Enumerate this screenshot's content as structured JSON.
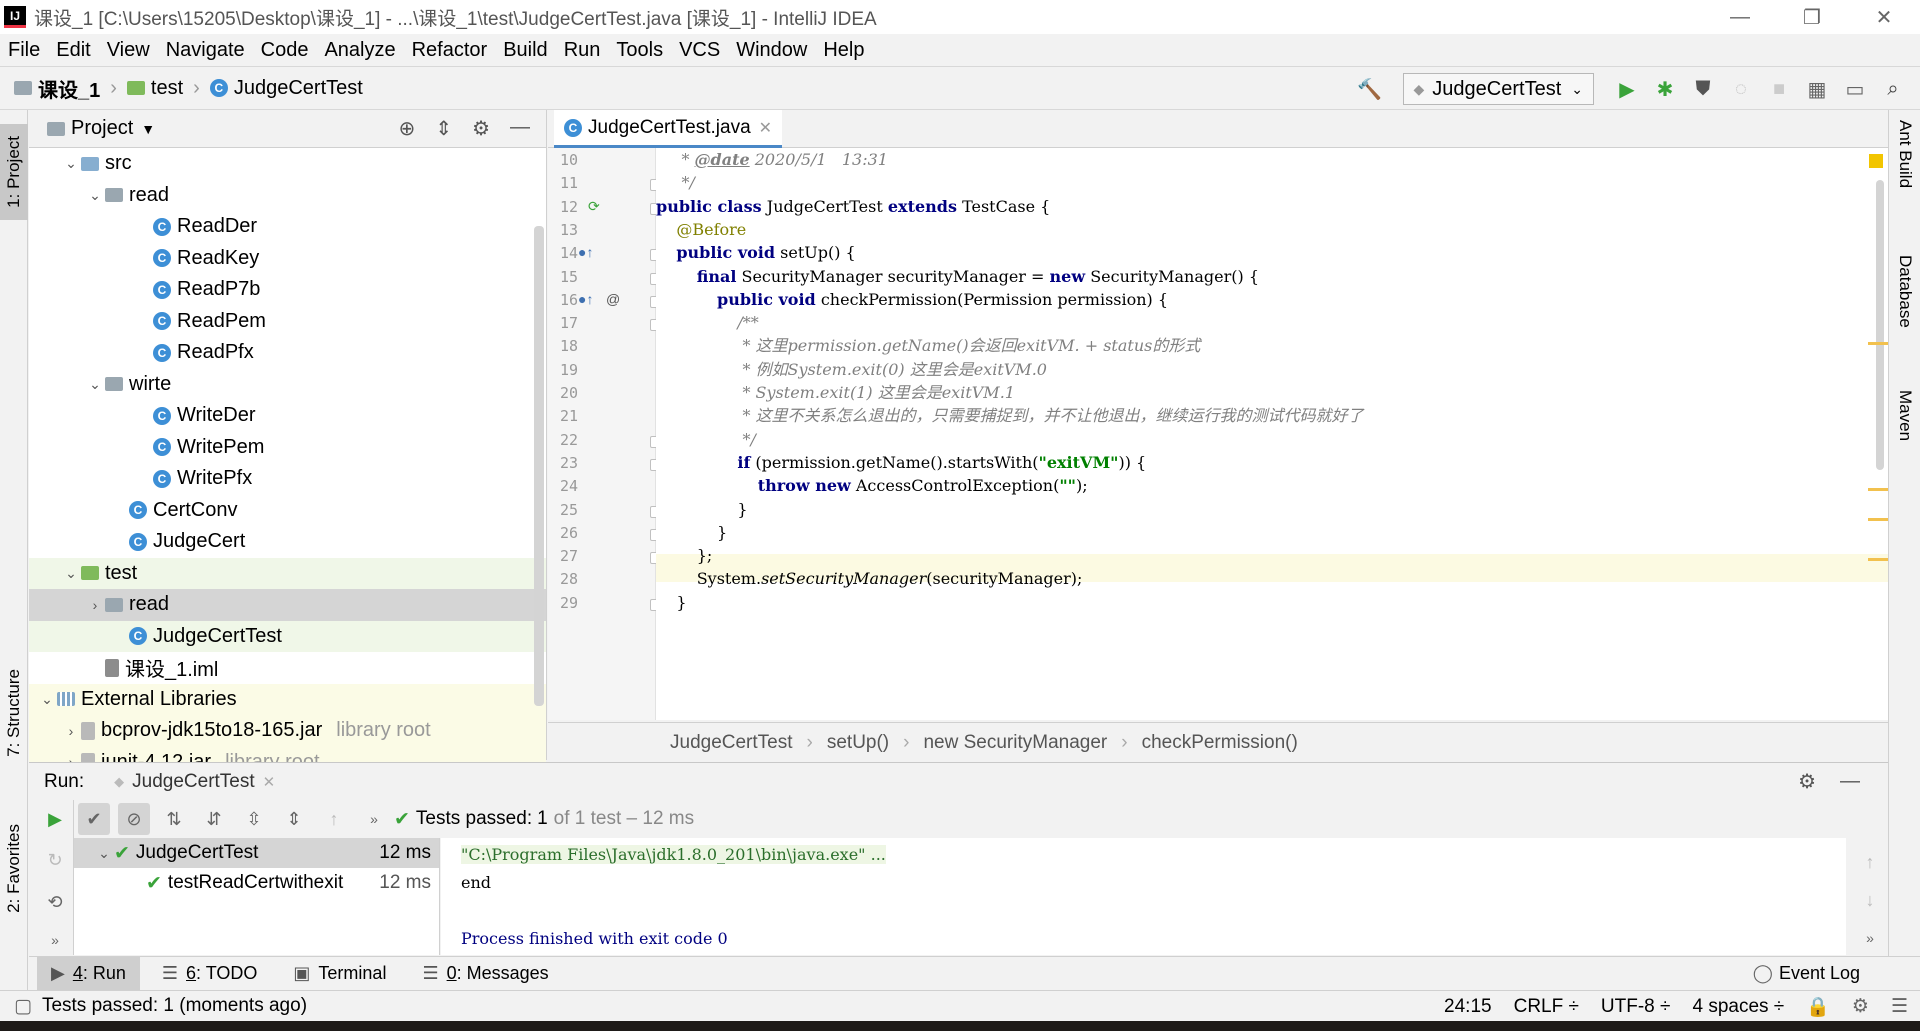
{
  "window": {
    "app_icon": "IJ",
    "title": "课设_1 [C:\\Users\\15205\\Desktop\\课设_1] - ...\\课设_1\\test\\JudgeCertTest.java [课设_1] - IntelliJ IDEA",
    "minimize": "—",
    "restore": "❐",
    "close": "✕"
  },
  "menu": [
    "File",
    "Edit",
    "View",
    "Navigate",
    "Code",
    "Analyze",
    "Refactor",
    "Build",
    "Run",
    "Tools",
    "VCS",
    "Window",
    "Help"
  ],
  "breadcrumb": [
    "课设_1",
    "test",
    "JudgeCertTest"
  ],
  "run_config": "JudgeCertTest",
  "left_tabs": {
    "project": "1: Project",
    "structure": "7: Structure",
    "favorites": "2: Favorites"
  },
  "right_tabs": {
    "ant": "Ant Build",
    "database": "Database",
    "maven": "Maven"
  },
  "project_panel": {
    "title": "Project",
    "tree": [
      {
        "label": "src",
        "kind": "folder-blue",
        "indent": 1,
        "arrow": "open"
      },
      {
        "label": "read",
        "kind": "package",
        "indent": 2,
        "arrow": "open"
      },
      {
        "label": "ReadDer",
        "kind": "class",
        "indent": 4
      },
      {
        "label": "ReadKey",
        "kind": "class",
        "indent": 4
      },
      {
        "label": "ReadP7b",
        "kind": "class",
        "indent": 4
      },
      {
        "label": "ReadPem",
        "kind": "class",
        "indent": 4
      },
      {
        "label": "ReadPfx",
        "kind": "class",
        "indent": 4
      },
      {
        "label": "wirte",
        "kind": "package",
        "indent": 2,
        "arrow": "open"
      },
      {
        "label": "WriteDer",
        "kind": "class",
        "indent": 4
      },
      {
        "label": "WritePem",
        "kind": "class",
        "indent": 4
      },
      {
        "label": "WritePfx",
        "kind": "class",
        "indent": 4
      },
      {
        "label": "CertConv",
        "kind": "class",
        "indent": 3
      },
      {
        "label": "JudgeCert",
        "kind": "class",
        "indent": 3
      },
      {
        "label": "test",
        "kind": "folder-green",
        "indent": 1,
        "arrow": "open",
        "style": "hl"
      },
      {
        "label": "read",
        "kind": "package",
        "indent": 2,
        "arrow": "closed",
        "style": "sel"
      },
      {
        "label": "JudgeCertTest",
        "kind": "class",
        "indent": 3,
        "style": "hl"
      },
      {
        "label": "课设_1.iml",
        "kind": "file",
        "indent": 2
      },
      {
        "label": "External Libraries",
        "kind": "lib",
        "indent": 0,
        "arrow": "open",
        "style": "ylw"
      },
      {
        "label": "bcprov-jdk15to18-165.jar",
        "kind": "jar",
        "indent": 1,
        "arrow": "closed",
        "suffix": "library root",
        "style": "ylw"
      },
      {
        "label": "junit-4.12.jar",
        "kind": "jar",
        "indent": 1,
        "arrow": "closed",
        "suffix": "library root",
        "style": "ylw"
      }
    ]
  },
  "editor": {
    "tab": "JudgeCertTest.java",
    "lines": [
      {
        "n": "10",
        "html": "     <span class=\"cm\">* <span class=\"doc-tag\">@date</span> 2020/5/1   13:31</span>"
      },
      {
        "n": "11",
        "html": "     <span class=\"cm\">*/</span>"
      },
      {
        "n": "12",
        "html": "<span class=\"kw\">public class</span> JudgeCertTest <span class=\"kw\">extends</span> TestCase {"
      },
      {
        "n": "13",
        "html": "    <span class=\"ann\">@Before</span>"
      },
      {
        "n": "14",
        "html": "    <span class=\"kw\">public void</span> setUp() {"
      },
      {
        "n": "15",
        "html": "        <span class=\"kw\">final</span> SecurityManager securityManager = <span class=\"kw\">new</span> SecurityManager() {"
      },
      {
        "n": "16",
        "html": "            <span class=\"kw\">public void</span> checkPermission(Permission permission) {"
      },
      {
        "n": "17",
        "html": "                <span class=\"cm\">/**</span>"
      },
      {
        "n": "18",
        "html": "                 <span class=\"cm\">* 这里permission.getName()会返回exitVM. + status的形式</span>"
      },
      {
        "n": "19",
        "html": "                 <span class=\"cm\">* 例如System.exit(0) 这里会是exitVM.0</span>"
      },
      {
        "n": "20",
        "html": "                 <span class=\"cm\">* System.exit(1) 这里会是exitVM.1</span>"
      },
      {
        "n": "21",
        "html": "                 <span class=\"cm\">* 这里不关系怎么退出的，只需要捕捉到，并不让他退出，继续运行我的测试代码就好了</span>"
      },
      {
        "n": "22",
        "html": "                 <span class=\"cm\">*/</span>"
      },
      {
        "n": "23",
        "html": "                <span class=\"kw\">if</span> (permission.getName().startsWith(<span class=\"str\">\"exitVM\"</span>)) {"
      },
      {
        "n": "24",
        "html": "                    <span class=\"kw\">throw new</span> AccessControlException(<span class=\"str\">\"\"</span>);"
      },
      {
        "n": "25",
        "html": "                }"
      },
      {
        "n": "26",
        "html": "            }"
      },
      {
        "n": "27",
        "html": "        };"
      },
      {
        "n": "28",
        "html": "        System.<i>setSecurityManager</i>(securityManager);"
      },
      {
        "n": "29",
        "html": "    }"
      }
    ]
  },
  "code_breadcrumb": [
    "JudgeCertTest",
    "setUp()",
    "new SecurityManager",
    "checkPermission()"
  ],
  "run_panel": {
    "label": "Run:",
    "tab": "JudgeCertTest",
    "status_prefix": "Tests passed:",
    "status_count": "1",
    "status_suffix": "of 1 test – 12 ms",
    "tests": [
      {
        "name": "JudgeCertTest",
        "time": "12 ms"
      },
      {
        "name": "testReadCertwithexit",
        "time": "12 ms"
      }
    ],
    "console": [
      "\"C:\\Program Files\\Java\\jdk1.8.0_201\\bin\\java.exe\" ...",
      "end",
      "",
      "Process finished with exit code 0"
    ]
  },
  "bottom_tabs": [
    {
      "key": "4",
      "label": ": Run",
      "icon": "▶"
    },
    {
      "key": "6",
      "label": ": TODO",
      "icon": "☰"
    },
    {
      "key": "",
      "label": "Terminal",
      "icon": "▣"
    },
    {
      "key": "0",
      "label": ": Messages",
      "icon": "☰"
    }
  ],
  "event_log": "Event Log",
  "status": {
    "message": "Tests passed: 1 (moments ago)",
    "position": "24:15",
    "line_sep": "CRLF ÷",
    "encoding": "UTF-8 ÷",
    "indent": "4 spaces ÷"
  }
}
